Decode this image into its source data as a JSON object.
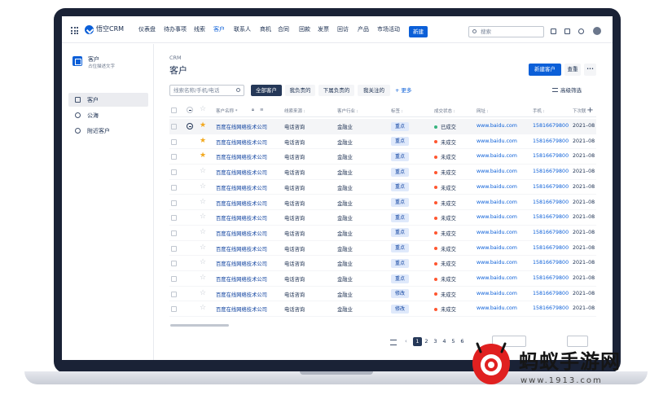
{
  "app": {
    "brand": "悟空CRM"
  },
  "nav": {
    "items": [
      "仪表盘",
      "待办事项",
      "线索",
      "客户",
      "联系人",
      "商机",
      "合同",
      "回款",
      "发票",
      "回访",
      "产品",
      "市场活动"
    ],
    "active_index": 3,
    "new_label": "新建",
    "search_placeholder": "搜索"
  },
  "sidebar": {
    "title": "客户",
    "subtitle": "占位描述文字",
    "items": [
      {
        "label": "客户",
        "icon": "sort-icon",
        "active": true
      },
      {
        "label": "公海",
        "icon": "user-icon",
        "active": false
      },
      {
        "label": "附近客户",
        "icon": "location-icon",
        "active": false
      }
    ]
  },
  "header": {
    "breadcrumb": "CRM",
    "title": "客户",
    "new_customer_label": "新建客户",
    "check_label": "查重",
    "more_label": "•••"
  },
  "filters": {
    "search_placeholder": "线索名称/手机/电话",
    "chips": [
      "全部客户",
      "我负责的",
      "下属负责的",
      "我关注的"
    ],
    "active_chip": 0,
    "more_label": "+ 更多",
    "advanced_label": "高级筛选"
  },
  "table": {
    "headers": {
      "name": "客户名称 *",
      "source": "线索来源 :",
      "industry": "客户行业 :",
      "tag": "标签 :",
      "deal_status": "成交状态 :",
      "website": "网址 :",
      "phone": "手机 :",
      "next": "下次联"
    },
    "rows": [
      {
        "name": "百度在线网络技术公司",
        "source": "电话咨询",
        "industry": "金融业",
        "tag": "重点",
        "status": "已成交",
        "status_color": "#36b37e",
        "website": "www.baidu.com",
        "phone": "15816679800",
        "date": "2021–08",
        "starred": true
      },
      {
        "name": "百度在线网络技术公司",
        "source": "电话咨询",
        "industry": "金融业",
        "tag": "重点",
        "status": "未成交",
        "status_color": "#ff5630",
        "website": "www.baidu.com",
        "phone": "15816679800",
        "date": "2021–08",
        "starred": true
      },
      {
        "name": "百度在线网络技术公司",
        "source": "电话咨询",
        "industry": "金融业",
        "tag": "重点",
        "status": "未成交",
        "status_color": "#ff5630",
        "website": "www.baidu.com",
        "phone": "15816679800",
        "date": "2021–08",
        "starred": true
      },
      {
        "name": "百度在线网络技术公司",
        "source": "电话咨询",
        "industry": "金融业",
        "tag": "重点",
        "status": "未成交",
        "status_color": "#ff5630",
        "website": "www.baidu.com",
        "phone": "15816679800",
        "date": "2021–08",
        "starred": false
      },
      {
        "name": "百度在线网络技术公司",
        "source": "电话咨询",
        "industry": "金融业",
        "tag": "重点",
        "status": "未成交",
        "status_color": "#ff5630",
        "website": "www.baidu.com",
        "phone": "15816679800",
        "date": "2021–08",
        "starred": false
      },
      {
        "name": "百度在线网络技术公司",
        "source": "电话咨询",
        "industry": "金融业",
        "tag": "重点",
        "status": "未成交",
        "status_color": "#ff5630",
        "website": "www.baidu.com",
        "phone": "15816679800",
        "date": "2021–08",
        "starred": false
      },
      {
        "name": "百度在线网络技术公司",
        "source": "电话咨询",
        "industry": "金融业",
        "tag": "重点",
        "status": "未成交",
        "status_color": "#ff5630",
        "website": "www.baidu.com",
        "phone": "15816679800",
        "date": "2021–08",
        "starred": false
      },
      {
        "name": "百度在线网络技术公司",
        "source": "电话咨询",
        "industry": "金融业",
        "tag": "重点",
        "status": "未成交",
        "status_color": "#ff5630",
        "website": "www.baidu.com",
        "phone": "15816679800",
        "date": "2021–08",
        "starred": false
      },
      {
        "name": "百度在线网络技术公司",
        "source": "电话咨询",
        "industry": "金融业",
        "tag": "重点",
        "status": "未成交",
        "status_color": "#ff5630",
        "website": "www.baidu.com",
        "phone": "15816679800",
        "date": "2021–08",
        "starred": false
      },
      {
        "name": "百度在线网络技术公司",
        "source": "电话咨询",
        "industry": "金融业",
        "tag": "重点",
        "status": "未成交",
        "status_color": "#ff5630",
        "website": "www.baidu.com",
        "phone": "15816679800",
        "date": "2021–08",
        "starred": false
      },
      {
        "name": "百度在线网络技术公司",
        "source": "电话咨询",
        "industry": "金融业",
        "tag": "重点",
        "status": "未成交",
        "status_color": "#ff5630",
        "website": "www.baidu.com",
        "phone": "15816679800",
        "date": "2021–08",
        "starred": false
      },
      {
        "name": "百度在线网络技术公司",
        "source": "电话咨询",
        "industry": "金融业",
        "tag": "修改",
        "status": "未成交",
        "status_color": "#ff5630",
        "website": "www.baidu.com",
        "phone": "15816679800",
        "date": "2021–08",
        "starred": false
      },
      {
        "name": "百度在线网络技术公司",
        "source": "电话咨询",
        "industry": "金融业",
        "tag": "修改",
        "status": "未成交",
        "status_color": "#ff5630",
        "website": "www.baidu.com",
        "phone": "15816679800",
        "date": "2021–08",
        "starred": false
      }
    ]
  },
  "pagination": {
    "prev": "‹",
    "pages": [
      "1",
      "2",
      "3",
      "4",
      "5",
      "6"
    ],
    "active_page": 0
  },
  "watermark": {
    "text": "蚂蚁手游网",
    "url": "www.1913.com"
  },
  "colors": {
    "primary": "#0b5fd8",
    "dark": "#253858",
    "frame": "#1a2236",
    "success": "#36b37e",
    "danger": "#ff5630"
  }
}
